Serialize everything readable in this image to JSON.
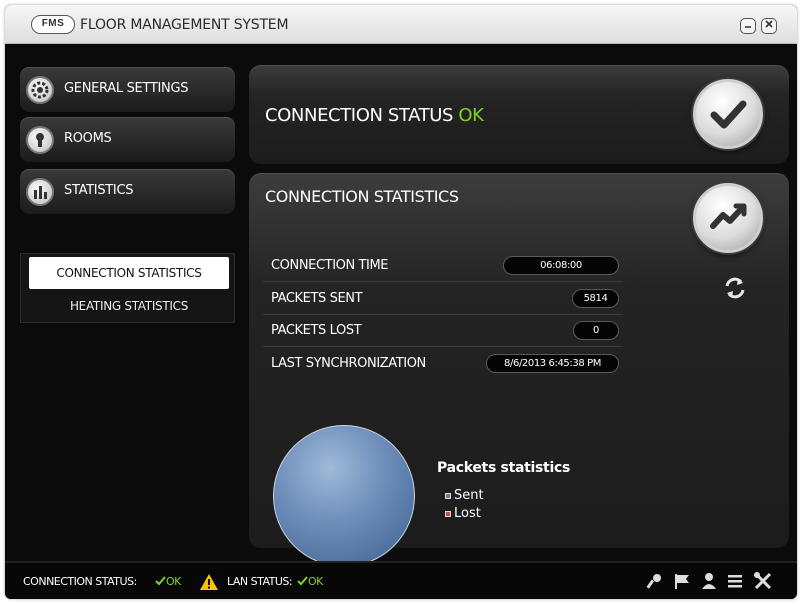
{
  "app": {
    "logo": "FMS",
    "title": "FLOOR MANAGEMENT SYSTEM",
    "minimize_icon": "minimize-icon",
    "close_icon": "close-icon"
  },
  "sidebar": {
    "items": [
      {
        "label": "GENERAL SETTINGS",
        "icon": "gear-icon"
      },
      {
        "label": "ROOMS",
        "icon": "keyhole-icon"
      },
      {
        "label": "STATISTICS",
        "icon": "bar-chart-icon"
      }
    ],
    "submenu": [
      {
        "label": "CONNECTION STATISTICS",
        "active": true
      },
      {
        "label": "HEATING STATISTICS",
        "active": false
      }
    ]
  },
  "connection_status": {
    "label": "CONNECTION STATUS",
    "value": "OK",
    "icon": "checkmark-icon"
  },
  "connection_statistics": {
    "title": "CONNECTION STATISTICS",
    "chart_icon": "trend-chart-icon",
    "refresh_icon": "refresh-icon",
    "rows": [
      {
        "label": "CONNECTION TIME",
        "value": "06:08:00"
      },
      {
        "label": "PACKETS SENT",
        "value": "5814"
      },
      {
        "label": "PACKETS LOST",
        "value": "0"
      },
      {
        "label": "LAST SYNCHRONIZATION",
        "value": "8/6/2013 6:45:38 PM"
      }
    ]
  },
  "chart_data": {
    "type": "pie",
    "title": "Packets statistics",
    "categories": [
      "Sent",
      "Lost"
    ],
    "values": [
      5814,
      0
    ],
    "colors": [
      "#5b7fb0",
      "#c0504d"
    ],
    "legend_position": "right"
  },
  "statusbar": {
    "connection_label": "CONNECTION STATUS:",
    "connection_value": "OK",
    "lan_label": "LAN STATUS:",
    "lan_value": "OK",
    "warning_icon": "warning-icon",
    "right_icons": [
      "wrench-icon",
      "flag-icon",
      "user-icon",
      "list-icon",
      "tools-icon"
    ]
  },
  "colors": {
    "ok_green": "#7ed321",
    "accent_warning": "#f5c400"
  }
}
